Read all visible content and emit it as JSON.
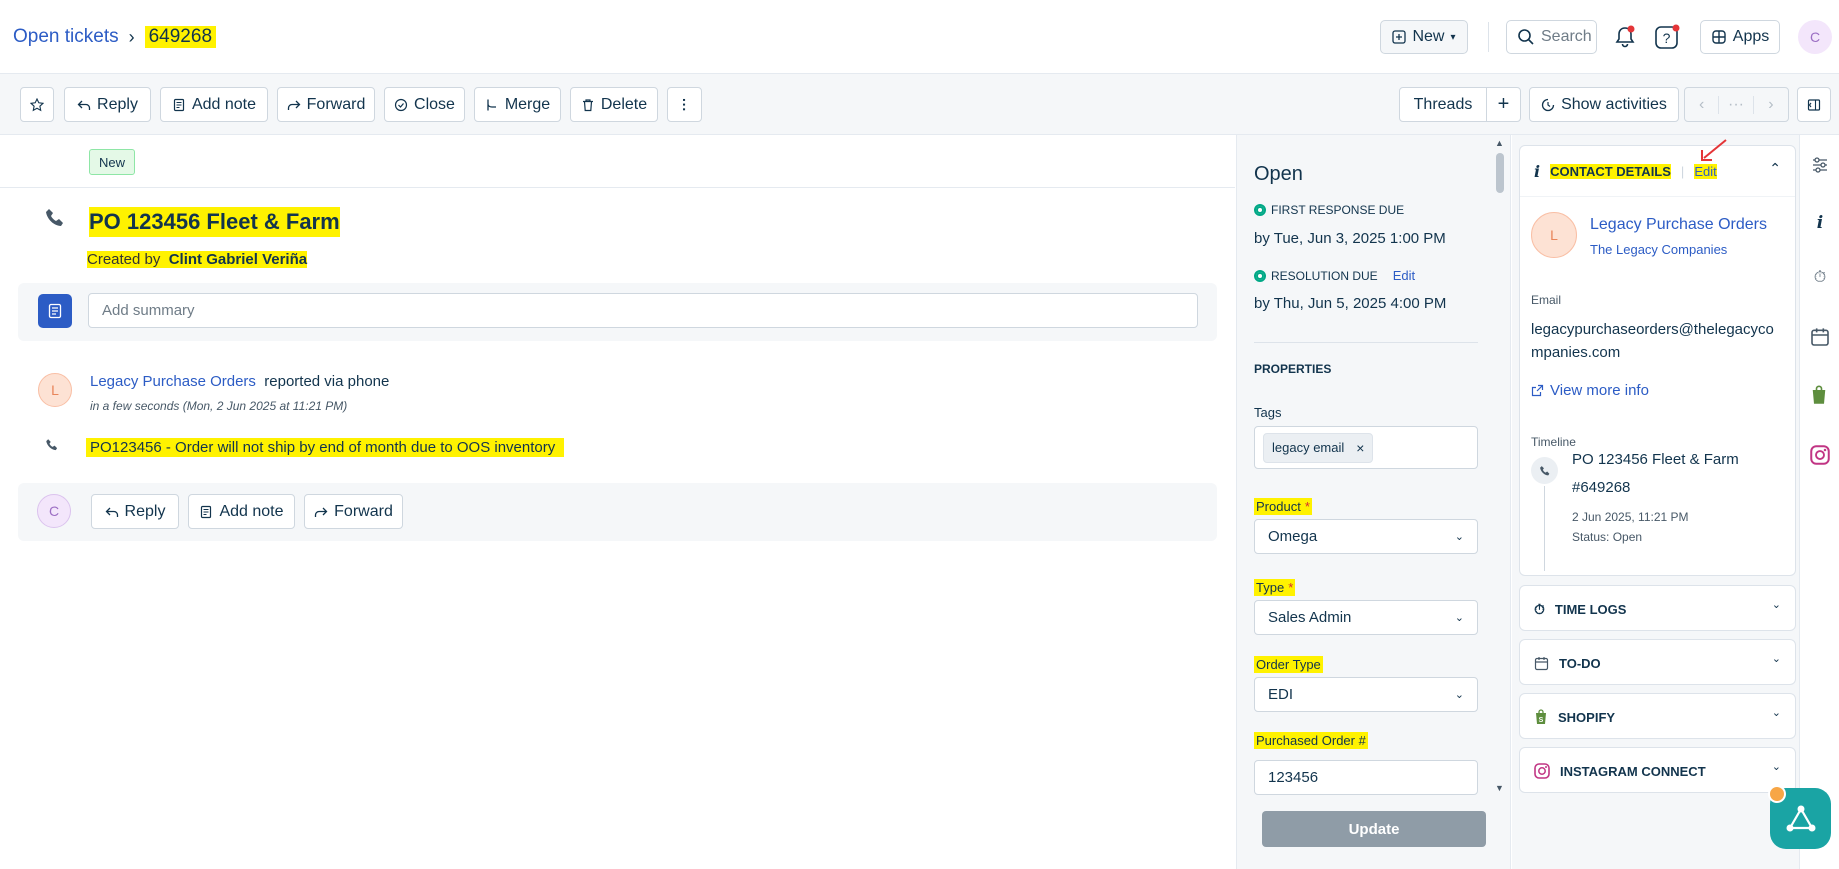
{
  "header": {
    "breadcrumb_parent": "Open tickets",
    "ticket_id": "649268",
    "new_label": "New",
    "search_placeholder": "Search",
    "apps_label": "Apps",
    "user_initial": "C"
  },
  "toolbar": {
    "reply": "Reply",
    "add_note": "Add note",
    "forward": "Forward",
    "close": "Close",
    "merge": "Merge",
    "delete": "Delete",
    "threads": "Threads",
    "show_activities": "Show activities",
    "pager_middle": "···"
  },
  "ticket": {
    "status_badge": "New",
    "title": "PO 123456 Fleet & Farm",
    "created_by_label": "Created by",
    "created_by_name": "Clint Gabriel Veriña",
    "summary_placeholder": "Add summary",
    "requester_initial": "L",
    "requester_name": "Legacy Purchase Orders",
    "reported_via": "reported via phone",
    "time_text": "in a few seconds (Mon, 2 Jun 2025 at 11:21 PM)",
    "message": "PO123456 - Order will not ship by end of month due to OOS inventory",
    "reply_initial": "C",
    "reply_label": "Reply",
    "add_note_label": "Add note",
    "forward_label": "Forward"
  },
  "properties": {
    "status": "Open",
    "first_response_label": "FIRST RESPONSE DUE",
    "first_response_value": "by Tue, Jun 3, 2025 1:00 PM",
    "resolution_label": "RESOLUTION DUE",
    "resolution_edit": "Edit",
    "resolution_value": "by Thu, Jun 5, 2025 4:00 PM",
    "section_title": "PROPERTIES",
    "tags_label": "Tags",
    "tag_value": "legacy email",
    "product_label": "Product",
    "product_value": "Omega",
    "type_label": "Type",
    "type_value": "Sales Admin",
    "order_type_label": "Order Type",
    "order_type_value": "EDI",
    "po_label": "Purchased Order #",
    "po_value": "123456",
    "required_mark": "*",
    "update_button": "Update"
  },
  "contact": {
    "section_title": "CONTACT DETAILS",
    "edit": "Edit",
    "initial": "L",
    "name": "Legacy Purchase Orders",
    "company": "The Legacy Companies",
    "email_label": "Email",
    "email_line1": "legacypurchaseorders@thelegacyco",
    "email_line2": "mpanies.com",
    "view_more": "View more info",
    "timeline_label": "Timeline",
    "timeline_title": "PO 123456 Fleet & Farm",
    "timeline_id": "#649268",
    "timeline_date": "2 Jun 2025, 11:21 PM",
    "timeline_status": "Status: Open"
  },
  "panels": {
    "time_logs": "TIME LOGS",
    "todo": "TO-DO",
    "shopify": "SHOPIFY",
    "instagram": "INSTAGRAM CONNECT"
  },
  "colors": {
    "accent": "#2c5cc5",
    "highlight": "#fff200",
    "sla_green": "#00a886",
    "update_button": "#8f9ca7"
  }
}
